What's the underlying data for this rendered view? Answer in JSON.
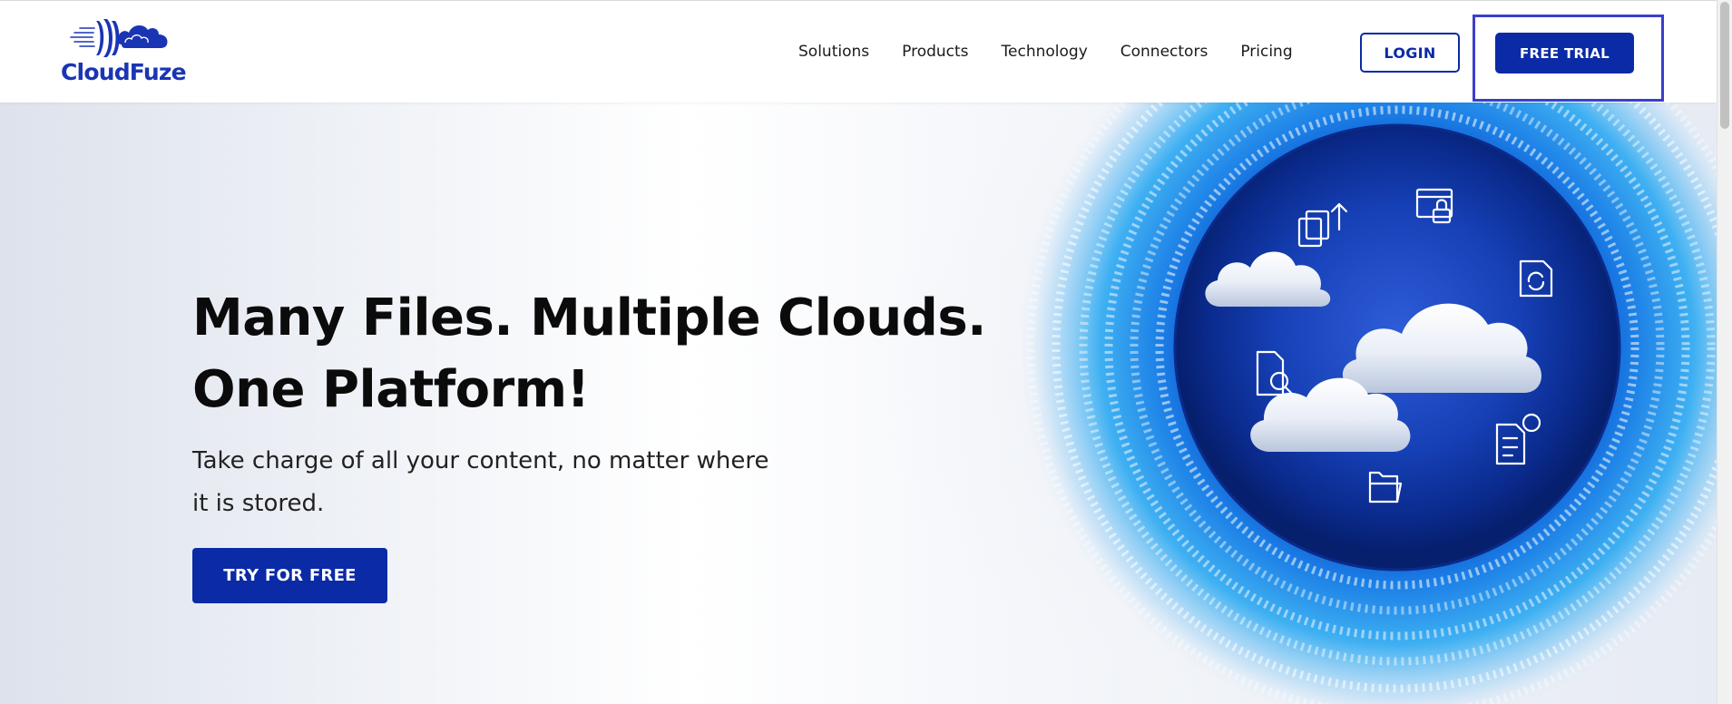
{
  "brand": {
    "name": "CloudFuze",
    "color": "#1a35b4"
  },
  "nav": {
    "items": [
      "Solutions",
      "Products",
      "Technology",
      "Connectors",
      "Pricing"
    ],
    "login_label": "LOGIN",
    "trial_label": "FREE TRIAL"
  },
  "hero": {
    "headline_line1": "Many Files. Multiple Clouds.",
    "headline_line2": "One Platform!",
    "subtitle": "Take charge of all your content, no matter where it is stored.",
    "cta_label": "TRY FOR FREE"
  },
  "colors": {
    "primary": "#0a2aa6",
    "focus_outline": "#3a3fc9",
    "text": "#0b0b0b"
  },
  "icons": [
    "cloud-icon",
    "upload-document-icon",
    "locked-folder-icon",
    "sync-document-icon",
    "search-document-icon",
    "shared-document-icon",
    "folder-icon"
  ]
}
